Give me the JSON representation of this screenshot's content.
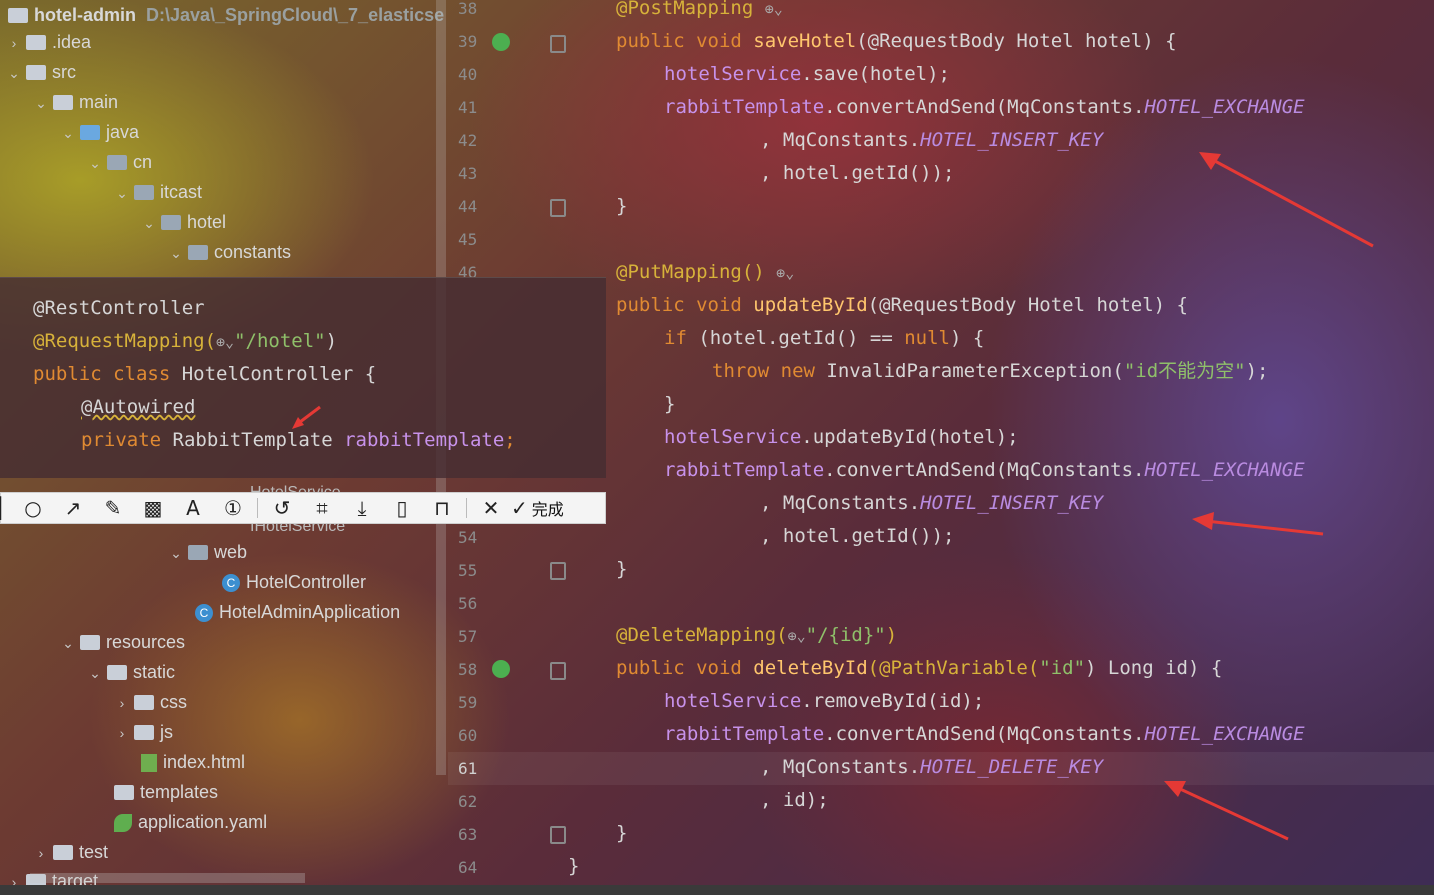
{
  "project": {
    "name": "hotel-admin",
    "path": "D:\\Java\\_SpringCloud\\_7_elasticse"
  },
  "tree": [
    {
      "label": ".idea",
      "arrow": "›",
      "kind": "folder"
    },
    {
      "label": "src",
      "arrow": "⌄",
      "kind": "folder"
    },
    {
      "label": "main",
      "arrow": "⌄",
      "kind": "folder"
    },
    {
      "label": "java",
      "arrow": "⌄",
      "kind": "folder-blue"
    },
    {
      "label": "cn",
      "arrow": "⌄",
      "kind": "package"
    },
    {
      "label": "itcast",
      "arrow": "⌄",
      "kind": "package"
    },
    {
      "label": "hotel",
      "arrow": "⌄",
      "kind": "package"
    },
    {
      "label": "constants",
      "arrow": "⌄",
      "kind": "package"
    },
    {
      "label": "web",
      "arrow": "⌄",
      "kind": "package"
    },
    {
      "label": "HotelController",
      "arrow": "",
      "kind": "class"
    },
    {
      "label": "HotelAdminApplication",
      "arrow": "",
      "kind": "spring-class"
    },
    {
      "label": "resources",
      "arrow": "⌄",
      "kind": "folder"
    },
    {
      "label": "static",
      "arrow": "⌄",
      "kind": "folder"
    },
    {
      "label": "css",
      "arrow": "›",
      "kind": "folder"
    },
    {
      "label": "js",
      "arrow": "›",
      "kind": "folder"
    },
    {
      "label": "index.html",
      "arrow": "",
      "kind": "html"
    },
    {
      "label": "templates",
      "arrow": "",
      "kind": "folder"
    },
    {
      "label": "application.yaml",
      "arrow": "",
      "kind": "yaml"
    },
    {
      "label": "test",
      "arrow": "›",
      "kind": "folder"
    },
    {
      "label": "target",
      "arrow": "›",
      "kind": "folder"
    }
  ],
  "hidden_tree_fragment": {
    "a": "HotelService",
    "b": "IHotelService"
  },
  "line_numbers": [
    "38",
    "39",
    "40",
    "41",
    "42",
    "43",
    "44",
    "45",
    "46",
    "54",
    "55",
    "56",
    "57",
    "58",
    "59",
    "60",
    "61",
    "62",
    "63",
    "64"
  ],
  "code": {
    "l38": "@PostMapping",
    "l39_kw": "public void ",
    "l39_fn": "saveHotel",
    "l39_rest": "(@RequestBody Hotel hotel) {",
    "l40_fld": "hotelService",
    ".": ".",
    "l40_rest": ".save(hotel);",
    "l41_fld": "rabbitTemplate",
    "l41_mid": ".convertAndSend(MqConstants.",
    "l41_const": "HOTEL_EXCHANGE",
    "l42_pre": ", MqConstants.",
    "l42_const": "HOTEL_INSERT_KEY",
    "l43": ", hotel.getId());",
    "l44": "}",
    "l46": "@PutMapping()",
    "l47_kw": "public void ",
    "l47_fn": "updateById",
    "l47_rest": "(@RequestBody Hotel hotel) {",
    "l48_kw": "if ",
    "l48_rest": "(hotel.getId() == ",
    "l48_null": "null",
    "l48_end": ") {",
    "l49_kw": "throw new ",
    "l49_rest": "InvalidParameterException(",
    "l49_str": "\"id不能为空\"",
    "l49_end": ");",
    "l50": "}",
    "l51_fld": "hotelService",
    "l51_rest": ".updateById(hotel);",
    "l52_fld": "rabbitTemplate",
    "l52_mid": ".convertAndSend(MqConstants.",
    "l52_const": "HOTEL_EXCHANGE",
    "l53_pre": ", MqConstants.",
    "l53_const": "HOTEL_INSERT_KEY",
    "l54": ", hotel.getId());",
    "l55": "}",
    "l57_ann": "@DeleteMapping(",
    "l57_str": "\"/{id}\"",
    "l57_end": ")",
    "l58_kw": "public void ",
    "l58_fn": "deleteById",
    "l58_rest": "(@PathVariable(",
    "l58_str": "\"id\"",
    "l58_end": ") Long id) {",
    "l59_fld": "hotelService",
    "l59_rest": ".removeById(id);",
    "l60_fld": "rabbitTemplate",
    "l60_mid": ".convertAndSend(MqConstants.",
    "l60_const": "HOTEL_EXCHANGE",
    "l61_pre": ", MqConstants.",
    "l61_const": "HOTEL_DELETE_KEY",
    "l62": ", id);",
    "l63": "}",
    "l64": "}"
  },
  "popup": {
    "p1": "@RestController",
    "p2_ann": "@RequestMapping(",
    "p2_str": "\"/hotel\"",
    "p2_end": ")",
    "p3_kw": "public class ",
    "p3_rest": "HotelController {",
    "p4": "@Autowired",
    "p5_kw": "private ",
    "p5_type": "RabbitTemplate ",
    "p5_fld": "rabbitTemplate",
    ";": ";"
  },
  "toolbar": {
    "done_label": "完成",
    "icons": [
      "ellipse-icon",
      "arrow-icon",
      "pen-icon",
      "mosaic-icon",
      "text-icon",
      "number-icon",
      "undo-icon",
      "ocr-icon",
      "download-icon",
      "pin-icon",
      "bookmark-icon",
      "close-icon",
      "check-icon"
    ]
  },
  "colors": {
    "annotation": "#d7b23a",
    "keyword": "#e08a32",
    "method": "#ffc66d",
    "field": "#c792ea",
    "constant": "#b98be0",
    "string": "#8fc06a",
    "red_arrow": "#e53935"
  }
}
